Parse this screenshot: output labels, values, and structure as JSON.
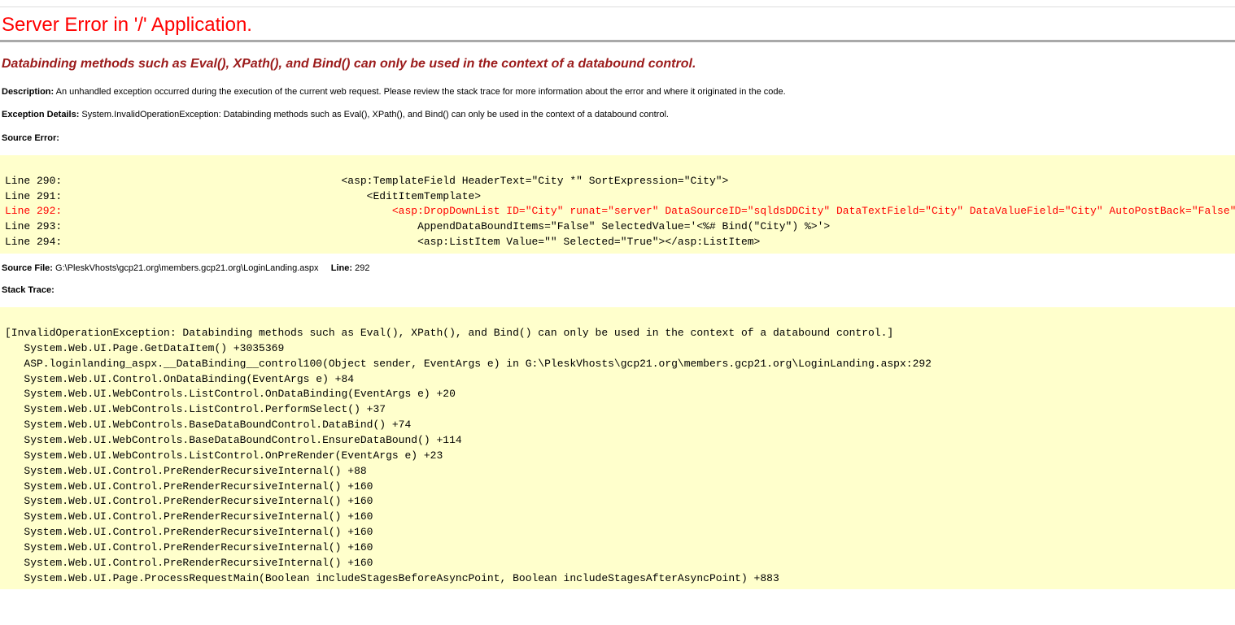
{
  "title": "Server Error in '/' Application.",
  "exception_message": "Databinding methods such as Eval(), XPath(), and Bind() can only be used in the context of a databound control.",
  "description_label": "Description:",
  "description_text": "An unhandled exception occurred during the execution of the current web request. Please review the stack trace for more information about the error and where it originated in the code.",
  "exception_details_label": "Exception Details:",
  "exception_details_text": "System.InvalidOperationException: Databinding methods such as Eval(), XPath(), and Bind() can only be used in the context of a databound control.",
  "source_error_label": "Source Error:",
  "source_lines": [
    {
      "n": "Line 290:",
      "text": "                                            <asp:TemplateField HeaderText=\"City *\" SortExpression=\"City\">",
      "err": false
    },
    {
      "n": "Line 291:",
      "text": "                                                <EditItemTemplate>",
      "err": false
    },
    {
      "n": "Line 292:",
      "text": "                                                    <asp:DropDownList ID=\"City\" runat=\"server\" DataSourceID=\"sqldsDDCity\" DataTextField=\"City\" DataValueField=\"City\" AutoPostBack=\"False\"",
      "err": true
    },
    {
      "n": "Line 293:",
      "text": "                                                        AppendDataBoundItems=\"False\" SelectedValue='<%# Bind(\"City\") %>'>",
      "err": false
    },
    {
      "n": "Line 294:",
      "text": "                                                        <asp:ListItem Value=\"\" Selected=\"True\"></asp:ListItem>",
      "err": false
    }
  ],
  "source_file_label": "Source File:",
  "source_file_text": "G:\\PleskVhosts\\gcp21.org\\members.gcp21.org\\LoginLanding.aspx",
  "line_label": "Line:",
  "line_number": "292",
  "stack_trace_label": "Stack Trace:",
  "stack_trace": "\n[InvalidOperationException: Databinding methods such as Eval(), XPath(), and Bind() can only be used in the context of a databound control.]\n   System.Web.UI.Page.GetDataItem() +3035369\n   ASP.loginlanding_aspx.__DataBinding__control100(Object sender, EventArgs e) in G:\\PleskVhosts\\gcp21.org\\members.gcp21.org\\LoginLanding.aspx:292\n   System.Web.UI.Control.OnDataBinding(EventArgs e) +84\n   System.Web.UI.WebControls.ListControl.OnDataBinding(EventArgs e) +20\n   System.Web.UI.WebControls.ListControl.PerformSelect() +37\n   System.Web.UI.WebControls.BaseDataBoundControl.DataBind() +74\n   System.Web.UI.WebControls.BaseDataBoundControl.EnsureDataBound() +114\n   System.Web.UI.WebControls.ListControl.OnPreRender(EventArgs e) +23\n   System.Web.UI.Control.PreRenderRecursiveInternal() +88\n   System.Web.UI.Control.PreRenderRecursiveInternal() +160\n   System.Web.UI.Control.PreRenderRecursiveInternal() +160\n   System.Web.UI.Control.PreRenderRecursiveInternal() +160\n   System.Web.UI.Control.PreRenderRecursiveInternal() +160\n   System.Web.UI.Control.PreRenderRecursiveInternal() +160\n   System.Web.UI.Control.PreRenderRecursiveInternal() +160\n   System.Web.UI.Page.ProcessRequestMain(Boolean includeStagesBeforeAsyncPoint, Boolean includeStagesAfterAsyncPoint) +883"
}
